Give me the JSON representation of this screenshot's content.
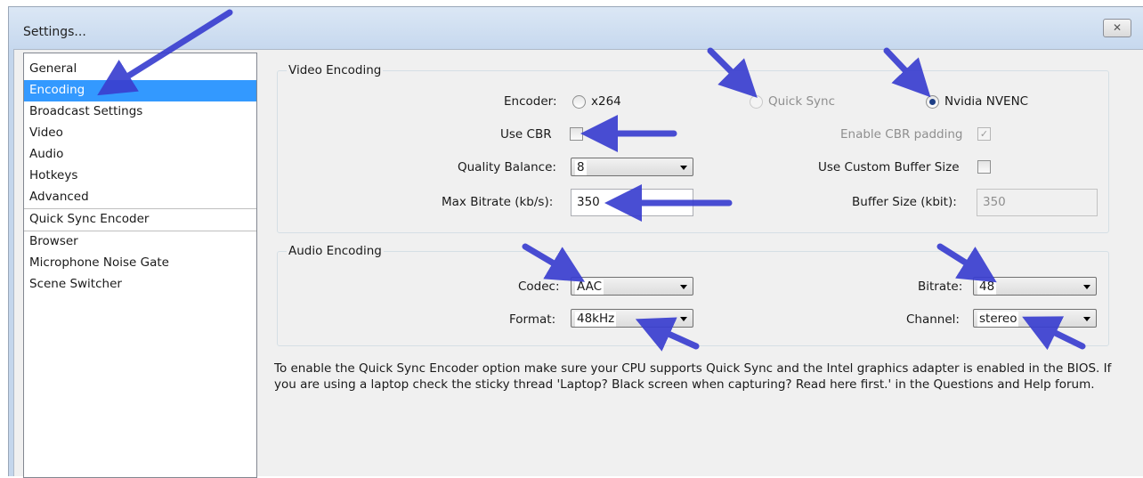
{
  "window": {
    "title": "Settings...",
    "close_label": "✕"
  },
  "sidebar": {
    "items": [
      {
        "label": "General"
      },
      {
        "label": "Encoding"
      },
      {
        "label": "Broadcast Settings"
      },
      {
        "label": "Video"
      },
      {
        "label": "Audio"
      },
      {
        "label": "Hotkeys"
      },
      {
        "label": "Advanced"
      },
      {
        "label": "Quick Sync Encoder"
      },
      {
        "label": "Browser"
      },
      {
        "label": "Microphone Noise Gate"
      },
      {
        "label": "Scene Switcher"
      }
    ]
  },
  "video": {
    "title": "Video Encoding",
    "encoder_label": "Encoder:",
    "x264_label": "x264",
    "quicksync_label": "Quick Sync",
    "nvenc_label": "Nvidia NVENC",
    "selected_encoder": "Nvidia NVENC",
    "usecbr_label": "Use CBR",
    "cbrpadding_label": "Enable CBR padding",
    "quality_label": "Quality Balance:",
    "quality_value": "8",
    "custombuffer_label": "Use Custom Buffer Size",
    "maxbitrate_label": "Max Bitrate (kb/s):",
    "maxbitrate_value": "350",
    "buffersize_label": "Buffer Size (kbit):",
    "buffersize_value": "350"
  },
  "audio": {
    "title": "Audio Encoding",
    "codec_label": "Codec:",
    "codec_value": "AAC",
    "bitrate_label": "Bitrate:",
    "bitrate_value": "48",
    "format_label": "Format:",
    "format_value": "48kHz",
    "channel_label": "Channel:",
    "channel_value": "stereo"
  },
  "info_text": "To enable the Quick Sync Encoder option make sure your CPU supports Quick Sync and the Intel graphics adapter is enabled in the BIOS. If you are using a laptop check the sticky thread 'Laptop? Black screen when capturing? Read here first.' in the Questions and Help forum.",
  "colors": {
    "selection": "#3399ff",
    "annotation_arrow": "#3a3fd0"
  }
}
